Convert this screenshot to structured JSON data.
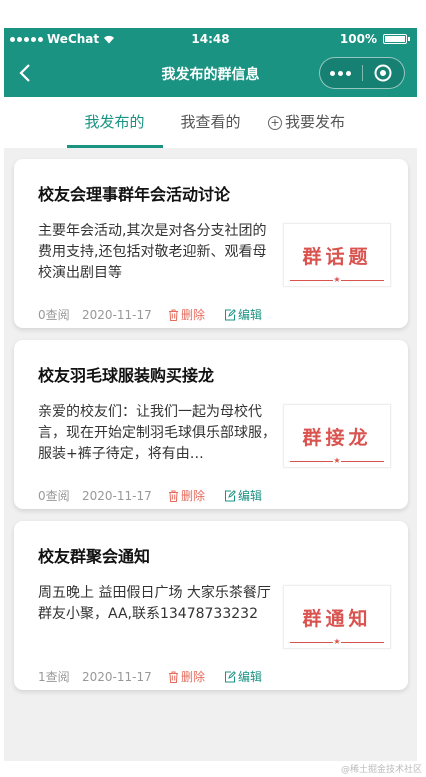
{
  "status_bar": {
    "carrier": "WeChat",
    "time": "14:48",
    "battery": "100%"
  },
  "nav": {
    "title": "我发布的群信息"
  },
  "tabs": [
    {
      "label": "我发布的",
      "active": true
    },
    {
      "label": "我查看的",
      "active": false
    },
    {
      "label": "我要发布",
      "active": false
    }
  ],
  "cards": [
    {
      "title": "校友会理事群年会活动讨论",
      "desc": "主要年会活动,其次是对各分支社团的费用支持,还包括对敬老迎新、观看母校演出剧目等",
      "stamp": "群话题",
      "views": "0查阅",
      "date": "2020-11-17",
      "delete_label": "删除",
      "edit_label": "编辑"
    },
    {
      "title": "校友羽毛球服装购买接龙",
      "desc": "亲爱的校友们：让我们一起为母校代言，现在开始定制羽毛球俱乐部球服，服装+裤子待定，将有由…",
      "stamp": "群接龙",
      "views": "0查阅",
      "date": "2020-11-17",
      "delete_label": "删除",
      "edit_label": "编辑"
    },
    {
      "title": "校友群聚会通知",
      "desc": "周五晚上 益田假日广场 大家乐茶餐厅 群友小聚，AA,联系13478733232",
      "stamp": "群通知",
      "views": "1查阅",
      "date": "2020-11-17",
      "delete_label": "删除",
      "edit_label": "编辑"
    }
  ],
  "watermark": "@稀土掘金技术社区",
  "colors": {
    "primary": "#1a9382",
    "stamp": "#d9534f",
    "delete": "#e46c5e"
  }
}
